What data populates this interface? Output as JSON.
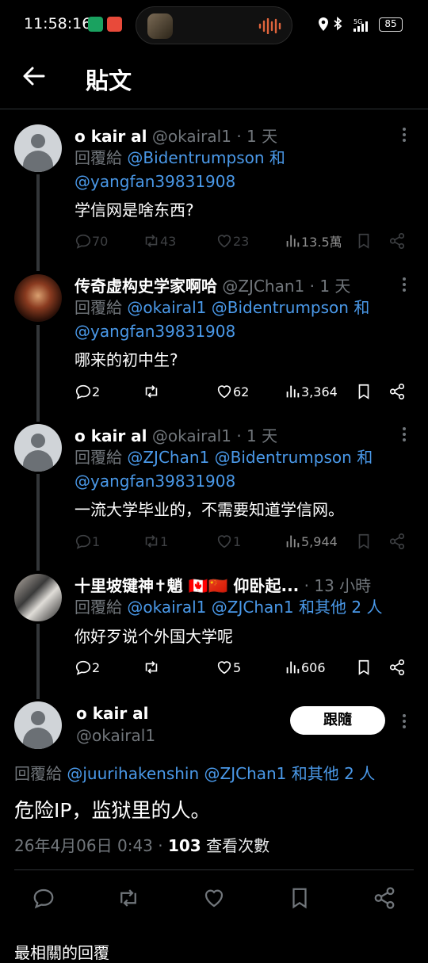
{
  "status_bar": {
    "time": "11:58:16",
    "battery": "85",
    "network": "5G"
  },
  "header": {
    "title": "貼文"
  },
  "tweets": [
    {
      "name": "o kair al",
      "handle": "@okairal1",
      "time": "· 1 天",
      "reply_prefix": "回覆給",
      "reply_to": "@Bidentrumpson",
      "reply_and": "和",
      "reply_to2": "@yangfan39831908",
      "text": "学信网是啥东西?",
      "replies": "70",
      "retweets": "43",
      "likes": "23",
      "views": "13.5萬"
    },
    {
      "name": "传奇虚构史学家啊哈",
      "handle": "@ZJChan1",
      "time": "· 1 天",
      "reply_prefix": "回覆給",
      "reply_to": "@okairal1 @Bidentrumpson",
      "reply_and": "和",
      "reply_to2": "@yangfan39831908",
      "text": "哪来的初中生?",
      "replies": "2",
      "retweets": "",
      "likes": "62",
      "views": "3,364"
    },
    {
      "name": "o kair al",
      "handle": "@okairal1",
      "time": "· 1 天",
      "reply_prefix": "回覆給",
      "reply_to": "@ZJChan1 @Bidentrumpson",
      "reply_and": "和",
      "reply_to2": "@yangfan39831908",
      "text": "一流大学毕业的，不需要知道学信网。",
      "replies": "1",
      "retweets": "1",
      "likes": "1",
      "views": "5,944"
    },
    {
      "name": "十里坡键神✝魈 🇨🇦🇨🇳 仰卧起...",
      "handle": "",
      "time": "· 13 小時",
      "reply_prefix": "回覆給",
      "reply_to": "@okairal1 @ZJChan1",
      "reply_and": "和其他 2 人",
      "text": "你好歹说个外国大学呢",
      "replies": "2",
      "retweets": "",
      "likes": "5",
      "views": "606"
    }
  ],
  "main_tweet": {
    "name": "o kair al",
    "handle": "@okairal1",
    "follow_label": "跟隨",
    "reply_prefix": "回覆給",
    "reply_to": "@juurihakenshin @ZJChan1",
    "reply_and": "和其他 2 人",
    "text": "危险IP，监狱里的人。",
    "date": "26年4月06日 0:43 ·",
    "view_count": "103",
    "view_label": "查看次數"
  },
  "next_section": {
    "label": "最相關的回覆"
  },
  "colors": {
    "link": "#4a99e9",
    "muted": "#71767b",
    "background": "#000000"
  }
}
